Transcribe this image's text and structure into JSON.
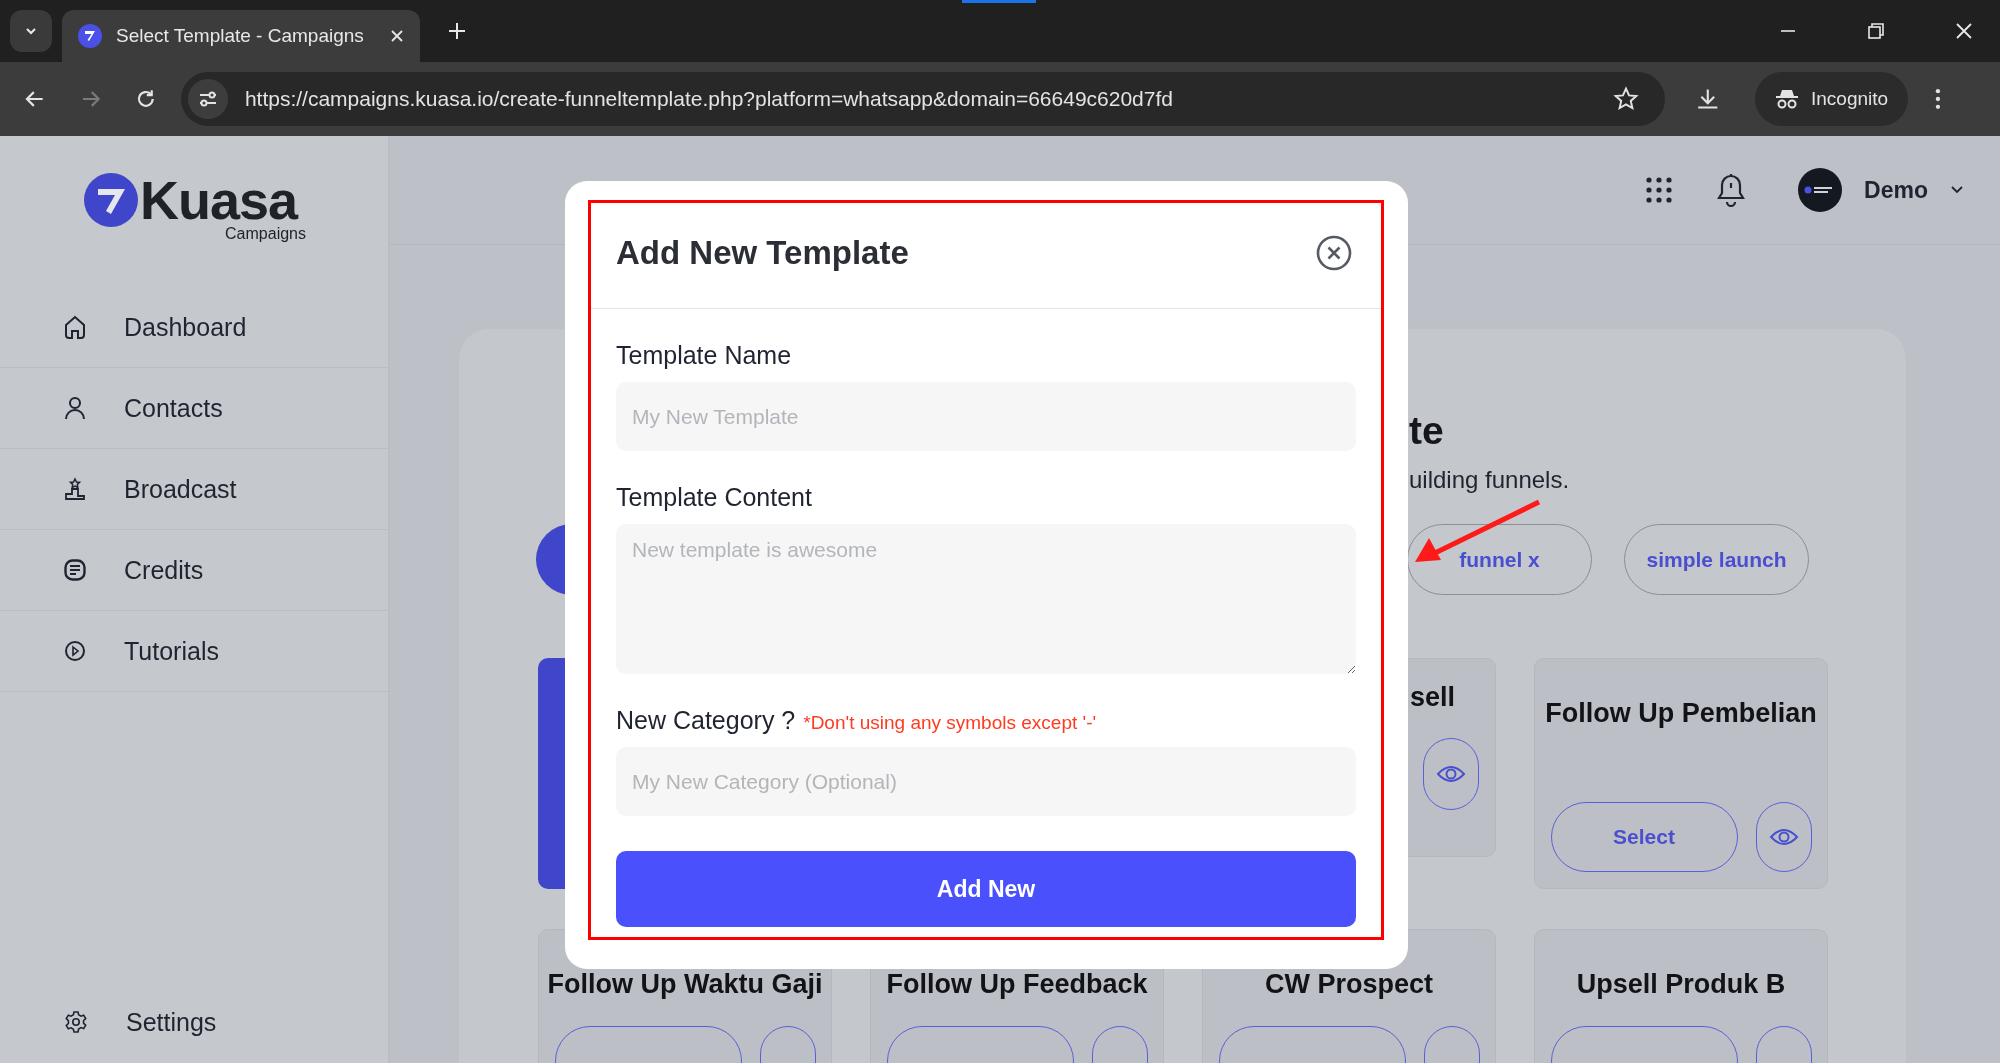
{
  "browser": {
    "tab_title": "Select Template - Campaigns",
    "url": "https://campaigns.kuasa.io/create-funneltemplate.php?platform=whatsapp&domain=66649c620d7fd",
    "forward_disabled": true,
    "profile_label": "Incognito"
  },
  "sidebar": {
    "logo": "Kuasa",
    "logo_sub": "Campaigns",
    "items": [
      {
        "label": "Dashboard"
      },
      {
        "label": "Contacts"
      },
      {
        "label": "Broadcast"
      },
      {
        "label": "Credits"
      },
      {
        "label": "Tutorials"
      }
    ],
    "footer_item": {
      "label": "Settings"
    }
  },
  "header": {
    "user_name": "Demo"
  },
  "page": {
    "title_fragment": "te",
    "subtitle_fragment": "uilding funnels.",
    "chips": [
      {
        "label": "funnel x"
      },
      {
        "label": "simple launch"
      }
    ],
    "cards_row_1": [
      {
        "kind": "accent"
      },
      {
        "kind": "partial",
        "title": "sell"
      },
      {
        "kind": "full",
        "title": "Follow Up Pembelian",
        "button": "Select"
      }
    ],
    "cards_row_2": [
      {
        "kind": "full",
        "title": "Follow Up Waktu Gaji"
      },
      {
        "kind": "full",
        "title": "Follow Up Feedback"
      },
      {
        "kind": "full",
        "title": "CW Prospect"
      },
      {
        "kind": "full",
        "title": "Upsell Produk B"
      }
    ]
  },
  "modal": {
    "title": "Add New Template",
    "fields": [
      {
        "kind": "input",
        "label": "Template Name",
        "placeholder": "My New Template"
      },
      {
        "kind": "textarea",
        "label": "Template Content",
        "placeholder": "New template is awesome"
      },
      {
        "kind": "input",
        "label": "New Category ?",
        "note": "*Don't using any symbols except '-'",
        "placeholder": "My New Category (Optional)"
      }
    ],
    "submit": "Add New"
  }
}
